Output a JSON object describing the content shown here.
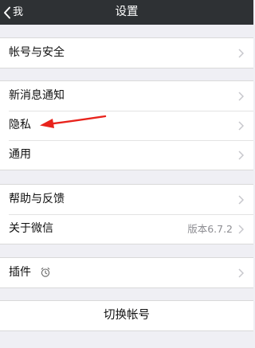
{
  "nav": {
    "back_label": "我",
    "title": "设置"
  },
  "groups": [
    {
      "items": [
        {
          "label": "帐号与安全"
        }
      ]
    },
    {
      "items": [
        {
          "label": "新消息通知"
        },
        {
          "label": "隐私"
        },
        {
          "label": "通用"
        }
      ]
    },
    {
      "items": [
        {
          "label": "帮助与反馈"
        },
        {
          "label": "关于微信",
          "value": "版本6.7.2"
        }
      ]
    },
    {
      "items": [
        {
          "label": "插件",
          "icon": "alarm-clock-icon"
        }
      ]
    },
    {
      "items": [
        {
          "label": "切换帐号"
        }
      ]
    }
  ],
  "colors": {
    "nav_bg": "#2e3134",
    "page_bg": "#efeff4",
    "annotation_arrow": "#e8231c"
  },
  "icons": {
    "back": "chevron-left-icon",
    "row_disclosure": "chevron-right-icon"
  }
}
